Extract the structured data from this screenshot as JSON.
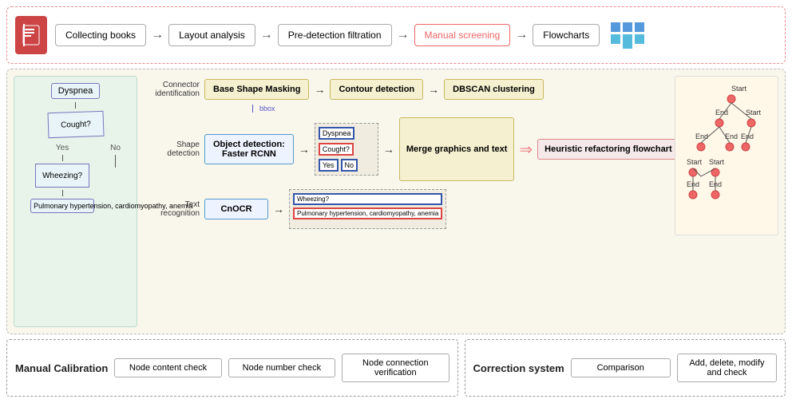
{
  "pipeline": {
    "steps": [
      {
        "label": "Collecting books"
      },
      {
        "label": "Layout analysis"
      },
      {
        "label": "Pre-detection filtration"
      },
      {
        "label": "Manual screening",
        "highlighted": true
      },
      {
        "label": "Flowcharts"
      }
    ],
    "arrows": [
      "→",
      "→",
      "→",
      "→"
    ]
  },
  "left_flowchart": {
    "nodes": [
      "Dyspnea",
      "Cought?",
      "Yes",
      "No",
      "Wheezing?",
      "Pulmonary hypertension, cardiomyopathy, anemia"
    ]
  },
  "processing": {
    "row1": {
      "label": "Connector identification",
      "box1": "Base Shape Masking",
      "arrow1": "→",
      "box2": "Contour detection",
      "arrow2": "→",
      "box3": "DBSCAN clustering"
    },
    "bbox_label": "bbox",
    "row2": {
      "label": "Shape detection",
      "box1": "Object detection: Faster RCNN"
    },
    "row3": {
      "label": "Text recognition",
      "box1": "CnOCR"
    },
    "merge": "Merge graphics and text",
    "heuristic": "Heuristic refactoring flowchart"
  },
  "bottom": {
    "left_title": "Manual Calibration",
    "checks": [
      "Node content check",
      "Node number check",
      "Node connection verification"
    ],
    "right_title": "Correction system",
    "right_checks": [
      "Comparison",
      "Add, delete, modify and check"
    ]
  }
}
